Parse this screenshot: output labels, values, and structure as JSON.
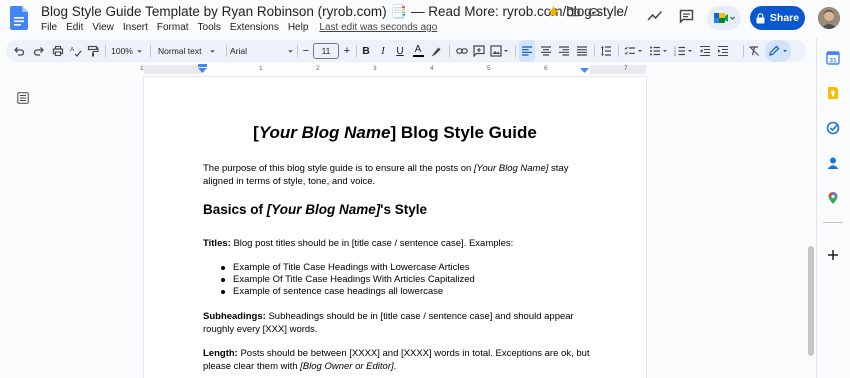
{
  "document": {
    "title": "Blog Style Guide Template by Ryan Robinson (ryrob.com) 📑 — Read More: ryrob.com/blog-style/",
    "last_edit": "Last edit was seconds ago"
  },
  "menu": [
    "File",
    "Edit",
    "View",
    "Insert",
    "Format",
    "Tools",
    "Extensions",
    "Help"
  ],
  "header_actions": {
    "share_label": "Share"
  },
  "toolbar": {
    "zoom": "100%",
    "style": "Normal text",
    "font": "Arial",
    "font_size": "11",
    "minus": "−",
    "plus": "+"
  },
  "ruler": {
    "numbers": [
      "1",
      "1",
      "2",
      "3",
      "4",
      "5",
      "6",
      "7"
    ]
  },
  "content": {
    "h1_prefix": "[",
    "h1_italic": "Your Blog Name",
    "h1_suffix": "] Blog Style Guide",
    "intro_a": "The purpose of this blog style guide is to ensure all the posts on ",
    "intro_italic": "[Your Blog Name]",
    "intro_b": " stay aligned in terms of style, tone, and voice.",
    "h2_prefix": "Basics of ",
    "h2_italic": "[Your Blog Name]",
    "h2_suffix": "'s Style",
    "titles_label": "Titles:",
    "titles_text": " Blog post titles should be in [title case / sentence case]. Examples:",
    "bullets": [
      "Example of Title Case Headings with Lowercase Articles",
      "Example Of Title Case Headings With Articles Capitalized",
      "Example of sentence case headings all lowercase"
    ],
    "subheadings_label": "Subheadings:",
    "subheadings_text": " Subheadings should be in [title case / sentence case] and should appear roughly every [XXX] words.",
    "length_label": "Length:",
    "length_text": " Posts should be between [XXXX] and [XXXX] words in total. Exceptions are ok, but please clear them with ",
    "length_italic": "[Blog Owner or Editor]",
    "length_end": "."
  },
  "colors": {
    "share": "#0b57d0",
    "toolbar_bg": "#edf2fa",
    "docs_blue": "#4285f4"
  }
}
